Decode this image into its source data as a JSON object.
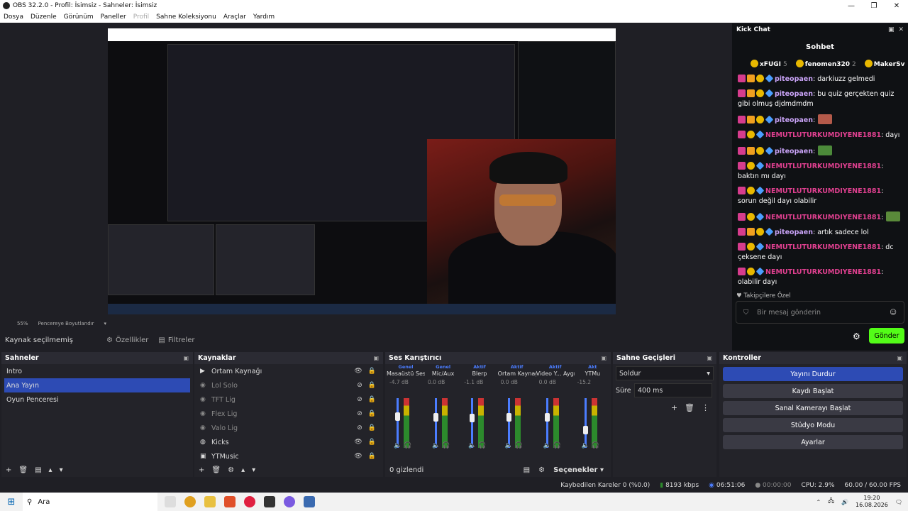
{
  "window": {
    "title": "OBS 32.2.0 - Profil: İsimsiz - Sahneler: İsimsiz",
    "controls": [
      "—",
      "❐",
      "✕"
    ]
  },
  "menu": [
    {
      "label": "Dosya",
      "disabled": false
    },
    {
      "label": "Düzenle",
      "disabled": false
    },
    {
      "label": "Görünüm",
      "disabled": false
    },
    {
      "label": "Paneller",
      "disabled": false
    },
    {
      "label": "Profil",
      "disabled": true
    },
    {
      "label": "Sahne Koleksiyonu",
      "disabled": false
    },
    {
      "label": "Araçlar",
      "disabled": false
    },
    {
      "label": "Yardım",
      "disabled": false
    }
  ],
  "preview_bar": {
    "zoom": "55%",
    "mode": "Pencereye Boyutlandır"
  },
  "source_bar": {
    "selected": "Kaynak seçilmemiş",
    "properties": "Özellikler",
    "filters": "Filtreler"
  },
  "chat": {
    "title": "Kick Chat",
    "channel": "Sohbet",
    "leaderboard": [
      {
        "rank": "1",
        "name": "xFUGI",
        "count": "5"
      },
      {
        "rank": "",
        "name": "fenomen320",
        "count": "2"
      },
      {
        "rank": "3",
        "name": "MakerSv",
        "count": ""
      }
    ],
    "messages": [
      {
        "user": "piteopaen",
        "type": "u2",
        "text": ": darkiuzz gelmedi"
      },
      {
        "user": "piteopaen",
        "type": "u2",
        "text": ": bu quiz gerçekten quiz gibi olmuş djdmdmdm"
      },
      {
        "user": "piteopaen",
        "type": "u2",
        "text": ":",
        "emote": "#b45a4a"
      },
      {
        "user": "NEMUTLUTURKUMDIYENE1881",
        "type": "u1",
        "text": ": dayı"
      },
      {
        "user": "piteopaen",
        "type": "u2",
        "text": ":",
        "emote": "#4c8a3a"
      },
      {
        "user": "NEMUTLUTURKUMDIYENE1881",
        "type": "u1",
        "text": ": baktın mı dayı"
      },
      {
        "user": "NEMUTLUTURKUMDIYENE1881",
        "type": "u1",
        "text": ": sorun değil dayı olabilir"
      },
      {
        "user": "NEMUTLUTURKUMDIYENE1881",
        "type": "u1",
        "text": ":",
        "emote": "#5a8a3a"
      },
      {
        "user": "piteopaen",
        "type": "u2",
        "text": ": artık sadece lol"
      },
      {
        "user": "NEMUTLUTURKUMDIYENE1881",
        "type": "u1",
        "text": ": dc çeksene dayı"
      },
      {
        "user": "NEMUTLUTURKUMDIYENE1881",
        "type": "u1",
        "text": ": olabilir dayı"
      }
    ],
    "followers_only": "Takipçilere Özel",
    "input_placeholder": "Bir mesaj gönderin",
    "send": "Gönder"
  },
  "scenes": {
    "title": "Sahneler",
    "items": [
      {
        "label": "Intro",
        "selected": false
      },
      {
        "label": "Ana Yayın",
        "selected": true
      },
      {
        "label": "Oyun Penceresi",
        "selected": false
      }
    ]
  },
  "sources": {
    "title": "Kaynaklar",
    "items": [
      {
        "label": "Ortam Kaynağı",
        "icon": "play-icon",
        "visible": true
      },
      {
        "label": "Lol Solo",
        "icon": "game-icon",
        "visible": false
      },
      {
        "label": "TFT Lig",
        "icon": "game-icon",
        "visible": false
      },
      {
        "label": "Flex Lig",
        "icon": "game-icon",
        "visible": false
      },
      {
        "label": "Valo Lig",
        "icon": "game-icon",
        "visible": false
      },
      {
        "label": "Kicks",
        "icon": "browser-icon",
        "visible": true
      },
      {
        "label": "YTMusic",
        "icon": "window-icon",
        "visible": true
      }
    ]
  },
  "mixer": {
    "title": "Ses Karıştırıcı",
    "channels": [
      {
        "tag": "Genel",
        "name": "Masaüstü Ses",
        "db": "-4.7 dB",
        "level": 0.72
      },
      {
        "tag": "Genel",
        "name": "Mic/Aux",
        "db": "0.0 dB",
        "level": 0.7
      },
      {
        "tag": "Aktif",
        "name": "Blerp",
        "db": "-1.1 dB",
        "level": 0.68
      },
      {
        "tag": "Aktif",
        "name": "Ortam Kaynağı",
        "db": "0.0 dB",
        "level": 0.7
      },
      {
        "tag": "Aktif",
        "name": "Video Y... Aygıtı",
        "db": "0.0 dB",
        "level": 0.7
      },
      {
        "tag": "Akt",
        "name": "YTMu",
        "db": "-15.2",
        "level": 0.45
      }
    ],
    "hidden": "0 gizlendi",
    "options": "Seçenekler"
  },
  "transitions": {
    "title": "Sahne Geçişleri",
    "selected": "Soldur",
    "duration_label": "Süre",
    "duration": "400 ms"
  },
  "controls": {
    "title": "Kontroller",
    "buttons": [
      {
        "label": "Yayını Durdur",
        "active": true
      },
      {
        "label": "Kaydı Başlat",
        "active": false
      },
      {
        "label": "Sanal Kamerayı Başlat",
        "active": false
      },
      {
        "label": "Stüdyo Modu",
        "active": false
      },
      {
        "label": "Ayarlar",
        "active": false
      }
    ]
  },
  "status": {
    "dropped": "Kaybedilen Kareler 0 (%0.0)",
    "bitrate": "8193 kbps",
    "live": "06:51:06",
    "rec": "00:00:00",
    "cpu": "CPU: 2.9%",
    "fps": "60.00 / 60.00 FPS"
  },
  "taskbar": {
    "search": "Ara",
    "time": "19:20",
    "date": "16.08.2026"
  },
  "colors": {
    "accent": "#2d4bb4",
    "kick_green": "#53fc18"
  }
}
